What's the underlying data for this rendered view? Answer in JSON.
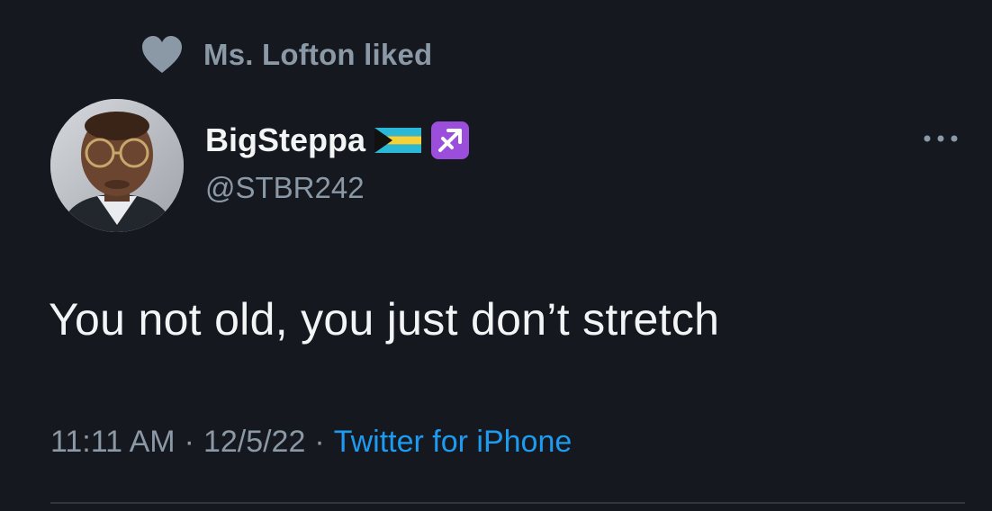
{
  "social_context": {
    "icon": "heart-icon",
    "text": "Ms. Lofton liked"
  },
  "author": {
    "display_name": "BigSteppa",
    "handle": "@STBR242",
    "emojis": [
      "bahamas-flag-emoji",
      "sagittarius-emoji"
    ]
  },
  "tweet": {
    "text": "You not old, you just don’t stretch"
  },
  "meta": {
    "time": "11:11 AM",
    "separator": "·",
    "date": "12/5/22",
    "source": "Twitter for iPhone"
  },
  "colors": {
    "background": "#15181f",
    "muted_text": "#8b98a5",
    "link": "#1d9bf0",
    "sagittarius_bg": "#9b4ddb"
  }
}
